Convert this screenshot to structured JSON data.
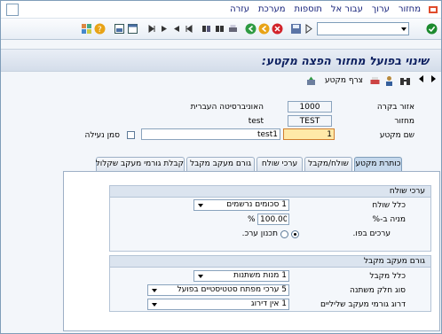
{
  "menu": {
    "items": [
      "מחזור",
      "ערוך",
      "עבור אל",
      "תוספות",
      "מערכת",
      "עזרה"
    ]
  },
  "title": "שינוי בפועל מחזור הפצה מקטע:",
  "app_toolbar": {
    "attach_label": "צרף מקטע"
  },
  "form": {
    "area_label": "אזור בקרה",
    "area_value": "1000",
    "area_desc": "האוניברסיטה העברית",
    "cycle_label": "מחזור",
    "cycle_value": "TEST",
    "cycle_desc": "test",
    "segment_label": "שם מקטע",
    "segment_value": "1",
    "segment_desc": "test1",
    "lock_label": "סמן נעילה"
  },
  "tabs": [
    "כותרת מקטע",
    "שולח/מקבל",
    "ערכי שולח",
    "גורם מעקב מקבל",
    "קבלת גורמי מעקב שקלול"
  ],
  "sender_group": {
    "header": "ערכי שולח",
    "rule_label": "כלל שולח",
    "rule_value": "1 סכומים נרשמים",
    "pct_label": "מניה ב-%",
    "pct_value": "100.00",
    "pct_unit": "%",
    "radio1_label": "ערכים בפו.",
    "radio2_label": "תכנון ערכ."
  },
  "receiver_group": {
    "header": "גורם מעקב מקבל",
    "rule_label": "כלל מקבל",
    "rule_value": "1 מנות משתנות",
    "type_label": "סוג חלק משתנה",
    "type_value": "5 ערכי מפתח סטטיסטיים בפועל",
    "scale_label": "דרוג גורמי מעקב שליליים",
    "scale_value": "1 אין דירוג"
  },
  "icons": {
    "enter": "green-check-icon",
    "save": "save-icon",
    "back": "green-arrow-back-icon",
    "exit": "yellow-exit-icon",
    "cancel": "red-cancel-icon"
  }
}
